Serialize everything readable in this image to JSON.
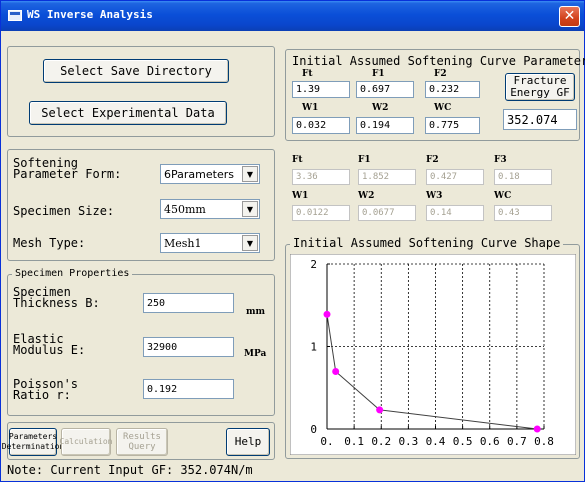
{
  "window": {
    "title": "WS Inverse Analysis",
    "close_glyph": "✕"
  },
  "buttons": {
    "save_directory": "Select Save Directory",
    "experimental_data": "Select Experimental Data",
    "fracture_energy": "Fracture\nEnergy GF",
    "params_determination": "Parameters\nDetermination",
    "calculation": "Calculation",
    "results_query": "Results\nQuery",
    "help": "Help"
  },
  "settings": {
    "softening_label": "Softening\nParameter Form:",
    "softening_value": "6Parameters",
    "specimen_size_label": "Specimen Size:",
    "specimen_size_value": "450mm",
    "mesh_type_label": "Mesh Type:",
    "mesh_type_value": "Mesh1"
  },
  "specimen": {
    "title": "Specimen Properties",
    "thickness_label": "Specimen\nThickness B:",
    "thickness_value": "250",
    "thickness_unit": "mm",
    "elastic_label": "Elastic\nModulus E:",
    "elastic_value": "32900",
    "elastic_unit": "MPa",
    "poisson_label": "Poisson's\nRatio r:",
    "poisson_value": "0.192"
  },
  "initial_params": {
    "title": "Initial Assumed Softening Curve Parameters",
    "labels": [
      "Ft",
      "F1",
      "F2",
      "W1",
      "W2",
      "WC"
    ],
    "values": [
      "1.39",
      "0.697",
      "0.232",
      "0.032",
      "0.194",
      "0.775"
    ],
    "gf_value": "352.074"
  },
  "result_params": {
    "labels": [
      "Ft",
      "F1",
      "F2",
      "F3",
      "W1",
      "W2",
      "W3",
      "WC"
    ],
    "values": [
      "3.36",
      "1.852",
      "0.427",
      "0.18",
      "0.0122",
      "0.0677",
      "0.14",
      "0.43"
    ]
  },
  "chart_data": {
    "type": "line",
    "title": "Initial Assumed Softening Curve Shape",
    "x": [
      0,
      0.032,
      0.194,
      0.775
    ],
    "y": [
      1.39,
      0.697,
      0.232,
      0
    ],
    "xlim": [
      0,
      0.8
    ],
    "ylim": [
      0,
      2
    ],
    "x_ticks": [
      "0.",
      "0.1",
      "0.2",
      "0.3",
      "0.4",
      "0.5",
      "0.6",
      "0.7",
      "0.8"
    ],
    "y_ticks": [
      "0",
      "1",
      "2"
    ],
    "grid": true,
    "line_color": "#404040",
    "marker_color": "#ff00ff"
  },
  "status": {
    "note": "Note: Current Input GF: 352.074N/m"
  }
}
